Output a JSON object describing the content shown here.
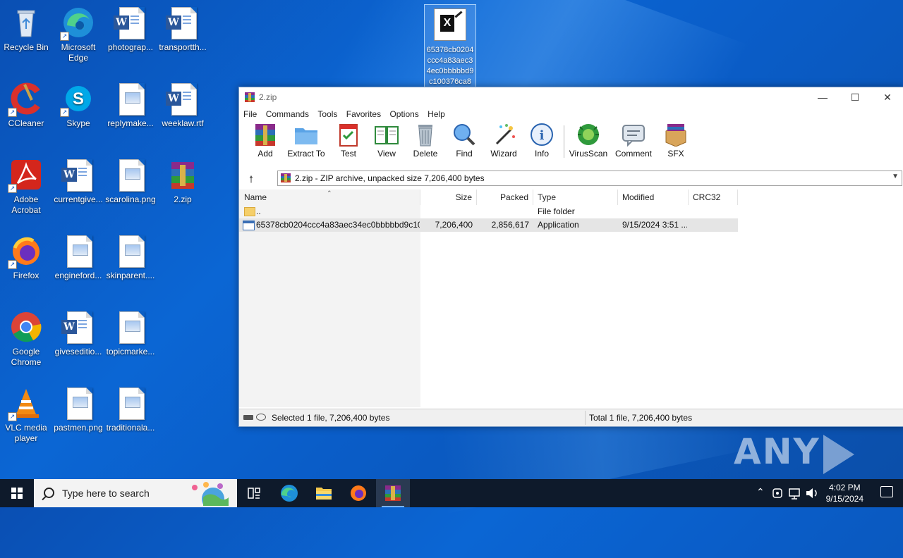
{
  "desktop": {
    "icons": [
      {
        "label": "Recycle Bin"
      },
      {
        "label": "Microsoft Edge"
      },
      {
        "label": "photograp..."
      },
      {
        "label": "transportth..."
      },
      {
        "label": "CCleaner"
      },
      {
        "label": "Skype"
      },
      {
        "label": "replymake..."
      },
      {
        "label": "weeklaw.rtf"
      },
      {
        "label": "Adobe Acrobat"
      },
      {
        "label": "currentgive..."
      },
      {
        "label": "scarolina.png"
      },
      {
        "label": "2.zip"
      },
      {
        "label": "Firefox"
      },
      {
        "label": "engineford..."
      },
      {
        "label": "skinparent...."
      },
      {
        "label": "Google Chrome"
      },
      {
        "label": "giveseditio..."
      },
      {
        "label": "topicmarke..."
      },
      {
        "label": "VLC media player"
      },
      {
        "label": "pastmen.png"
      },
      {
        "label": "traditionala..."
      }
    ],
    "selected_icon": {
      "label": "65378cb0204ccc4a83aec34ec0bbbbbd9c100376ca8"
    }
  },
  "window": {
    "title": "2.zip",
    "menu": [
      "File",
      "Commands",
      "Tools",
      "Favorites",
      "Options",
      "Help"
    ],
    "toolbar": [
      "Add",
      "Extract To",
      "Test",
      "View",
      "Delete",
      "Find",
      "Wizard",
      "Info",
      "VirusScan",
      "Comment",
      "SFX"
    ],
    "address": "2.zip - ZIP archive, unpacked size 7,206,400 bytes",
    "columns": [
      "Name",
      "Size",
      "Packed",
      "Type",
      "Modified",
      "CRC32"
    ],
    "rows": [
      {
        "name": "..",
        "size": "",
        "packed": "",
        "type": "File folder",
        "modified": "",
        "crc": ""
      },
      {
        "name": "65378cb0204ccc4a83aec34ec0bbbbbd9c10...",
        "size": "7,206,400",
        "packed": "2,856,617",
        "type": "Application",
        "modified": "9/15/2024 3:51 ...",
        "crc": ""
      }
    ],
    "status_left": "Selected 1 file, 7,206,400 bytes",
    "status_right": "Total 1 file, 7,206,400 bytes"
  },
  "watermark": {
    "left": "ANY",
    "right": "RUN"
  },
  "taskbar": {
    "search_placeholder": "Type here to search",
    "time": "4:02 PM",
    "date": "9/15/2024"
  }
}
